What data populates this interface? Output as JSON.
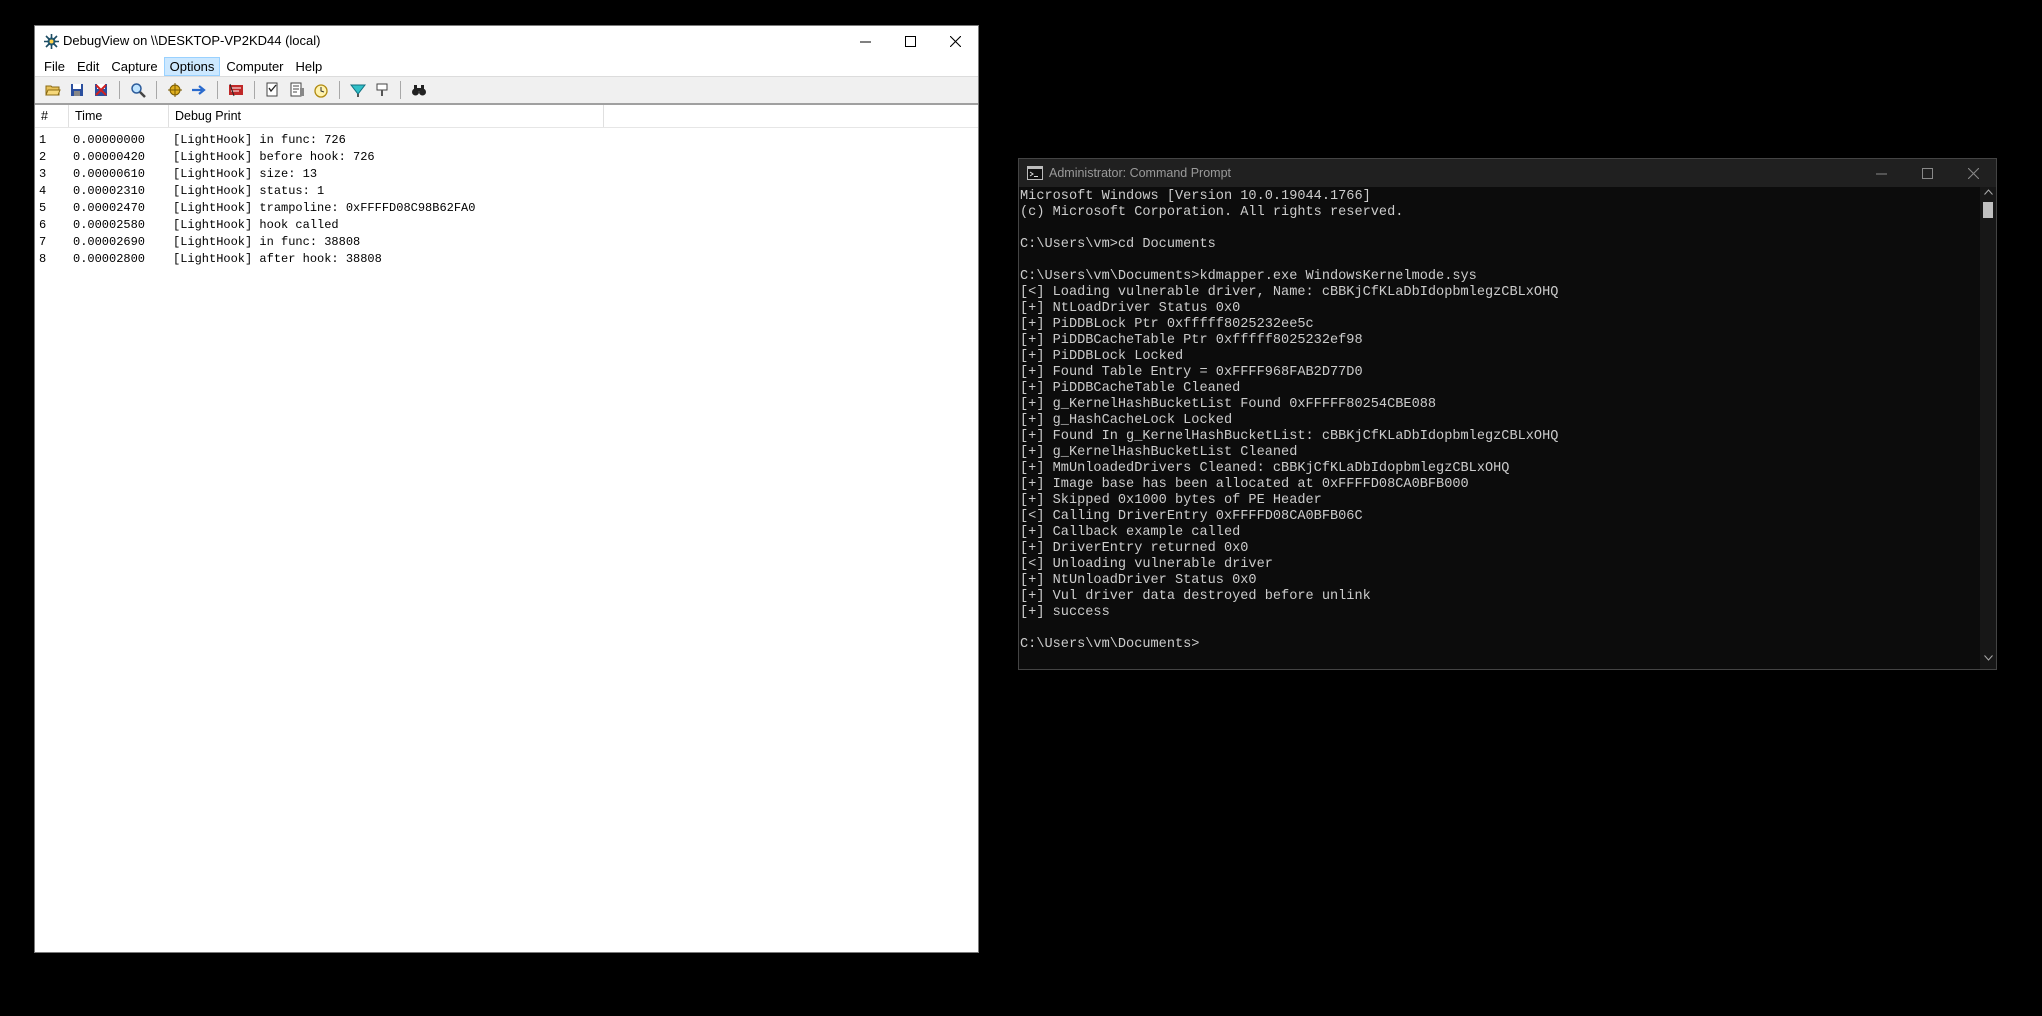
{
  "debugview": {
    "title": "DebugView on \\\\DESKTOP-VP2KD44 (local)",
    "menu": [
      "File",
      "Edit",
      "Capture",
      "Options",
      "Computer",
      "Help"
    ],
    "active_menu": "Options",
    "toolbar_icons": [
      "open-icon",
      "save-icon",
      "clear-icon",
      "find-icon",
      "capture-icon",
      "autoscroll-icon",
      "highlight-icon",
      "filter-icon",
      "history-icon",
      "clock-icon",
      "connect-icon",
      "disconnect-icon",
      "search-binoculars-icon"
    ],
    "columns": [
      "#",
      "Time",
      "Debug Print"
    ],
    "rows": [
      {
        "num": "1",
        "time": "0.00000000",
        "msg": "[LightHook] in func: 726"
      },
      {
        "num": "2",
        "time": "0.00000420",
        "msg": "[LightHook] before hook: 726"
      },
      {
        "num": "3",
        "time": "0.00000610",
        "msg": "[LightHook] size: 13"
      },
      {
        "num": "4",
        "time": "0.00002310",
        "msg": "[LightHook] status: 1"
      },
      {
        "num": "5",
        "time": "0.00002470",
        "msg": "[LightHook] trampoline: 0xFFFFD08C98B62FA0"
      },
      {
        "num": "6",
        "time": "0.00002580",
        "msg": "[LightHook] hook called"
      },
      {
        "num": "7",
        "time": "0.00002690",
        "msg": "[LightHook] in func: 38808"
      },
      {
        "num": "8",
        "time": "0.00002800",
        "msg": "[LightHook] after hook: 38808"
      }
    ]
  },
  "cmd": {
    "title": "Administrator: Command Prompt",
    "lines": [
      "Microsoft Windows [Version 10.0.19044.1766]",
      "(c) Microsoft Corporation. All rights reserved.",
      "",
      "C:\\Users\\vm>cd Documents",
      "",
      "C:\\Users\\vm\\Documents>kdmapper.exe WindowsKernelmode.sys",
      "[<] Loading vulnerable driver, Name: cBBKjCfKLaDbIdopbmlegzCBLxOHQ",
      "[+] NtLoadDriver Status 0x0",
      "[+] PiDDBLock Ptr 0xfffff8025232ee5c",
      "[+] PiDDBCacheTable Ptr 0xfffff8025232ef98",
      "[+] PiDDBLock Locked",
      "[+] Found Table Entry = 0xFFFF968FAB2D77D0",
      "[+] PiDDBCacheTable Cleaned",
      "[+] g_KernelHashBucketList Found 0xFFFFF80254CBE088",
      "[+] g_HashCacheLock Locked",
      "[+] Found In g_KernelHashBucketList: cBBKjCfKLaDbIdopbmlegzCBLxOHQ",
      "[+] g_KernelHashBucketList Cleaned",
      "[+] MmUnloadedDrivers Cleaned: cBBKjCfKLaDbIdopbmlegzCBLxOHQ",
      "[+] Image base has been allocated at 0xFFFFD08CA0BFB000",
      "[+] Skipped 0x1000 bytes of PE Header",
      "[<] Calling DriverEntry 0xFFFFD08CA0BFB06C",
      "[+] Callback example called",
      "[+] DriverEntry returned 0x0",
      "[<] Unloading vulnerable driver",
      "[+] NtUnloadDriver Status 0x0",
      "[+] Vul driver data destroyed before unlink",
      "[+] success",
      "",
      "C:\\Users\\vm\\Documents>"
    ]
  }
}
